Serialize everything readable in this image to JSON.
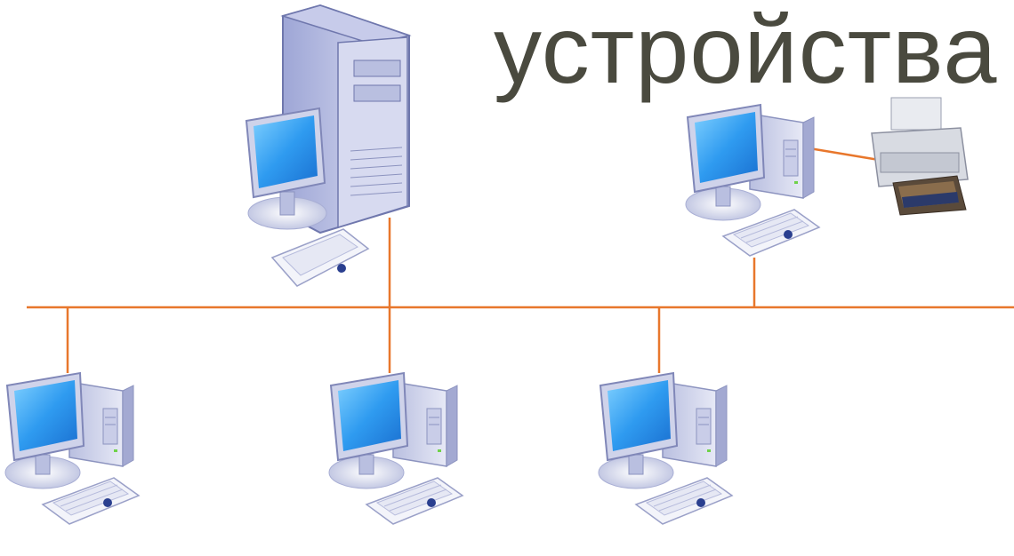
{
  "slide": {
    "title": "устройства"
  },
  "diagram": {
    "type": "bus-network",
    "colors": {
      "cable": "#e8772c",
      "screen": "#3aa6f2",
      "case": "#d9dcee",
      "text": "#4a4a3f"
    },
    "nodes": [
      {
        "id": "server",
        "kind": "server",
        "icon": "server-tower-icon"
      },
      {
        "id": "workstation-printer",
        "kind": "workstation",
        "icon": "desktop-computer-icon"
      },
      {
        "id": "printer",
        "kind": "printer",
        "icon": "printer-icon"
      },
      {
        "id": "workstation-1",
        "kind": "workstation",
        "icon": "desktop-computer-icon"
      },
      {
        "id": "workstation-2",
        "kind": "workstation",
        "icon": "desktop-computer-icon"
      },
      {
        "id": "workstation-3",
        "kind": "workstation",
        "icon": "desktop-computer-icon"
      }
    ],
    "connections": [
      {
        "from": "server",
        "to": "bus"
      },
      {
        "from": "workstation-printer",
        "to": "bus"
      },
      {
        "from": "workstation-printer",
        "to": "printer"
      },
      {
        "from": "workstation-1",
        "to": "bus"
      },
      {
        "from": "workstation-2",
        "to": "bus"
      },
      {
        "from": "workstation-3",
        "to": "bus"
      }
    ]
  }
}
